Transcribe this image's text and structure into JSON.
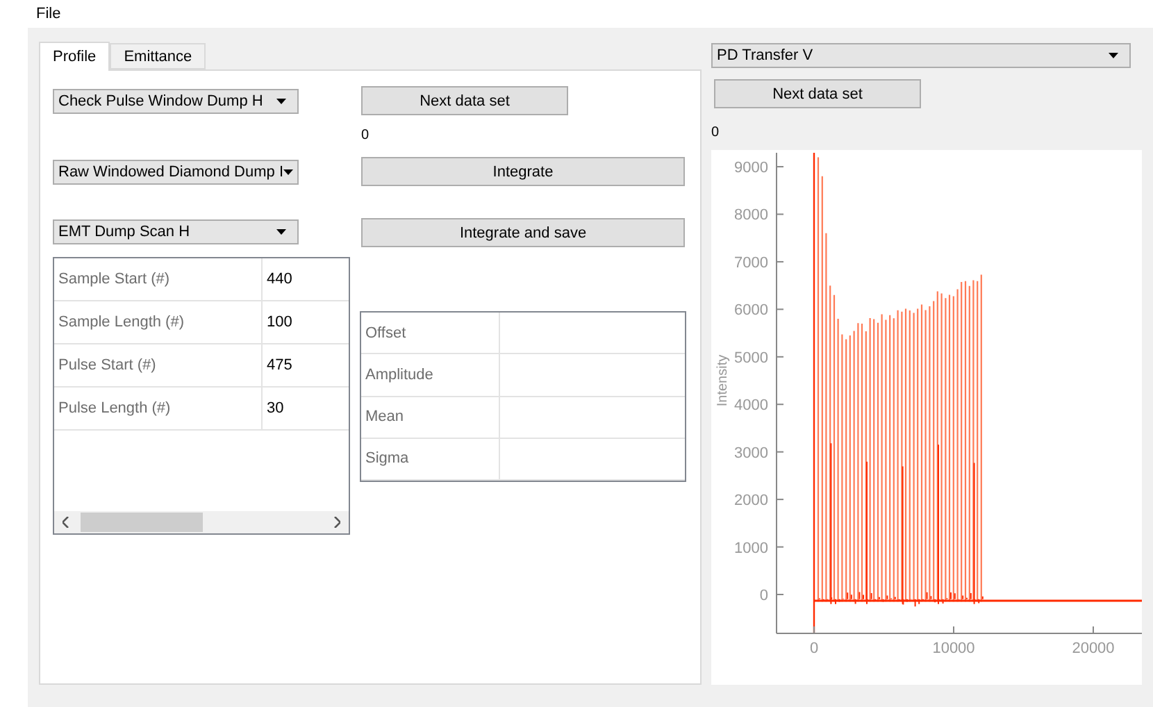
{
  "menu": [
    "File"
  ],
  "left_panel": {
    "tabs": [
      {
        "label": "Profile",
        "selected": true
      },
      {
        "label": "Emittance",
        "selected": false
      }
    ],
    "selectors": [
      "Check Pulse Window Dump H",
      "Raw Windowed Diamond Dump I",
      "EMT Dump Scan H"
    ],
    "buttons": [
      "Next data set",
      "Integrate",
      "Integrate and save"
    ],
    "counter": "0",
    "parameters": [
      {
        "name": "Sample Start (#)",
        "value": "440"
      },
      {
        "name": "Sample Length (#)",
        "value": "100"
      },
      {
        "name": "Pulse Start (#)",
        "value": "475"
      },
      {
        "name": "Pulse Length (#)",
        "value": "30"
      }
    ],
    "results": [
      "Offset",
      "Amplitude",
      "Mean",
      "Sigma"
    ]
  },
  "right_panel": {
    "selector": "PD Transfer V",
    "button": "Next data set",
    "counter": "0",
    "plot": {
      "ylabel": "Intensity",
      "yticks": [
        "9000",
        "8000",
        "7000",
        "6000",
        "5000",
        "4000",
        "3000",
        "2000",
        "1000",
        "0"
      ],
      "xticks": [
        "0",
        "10000",
        "20000"
      ]
    }
  }
}
